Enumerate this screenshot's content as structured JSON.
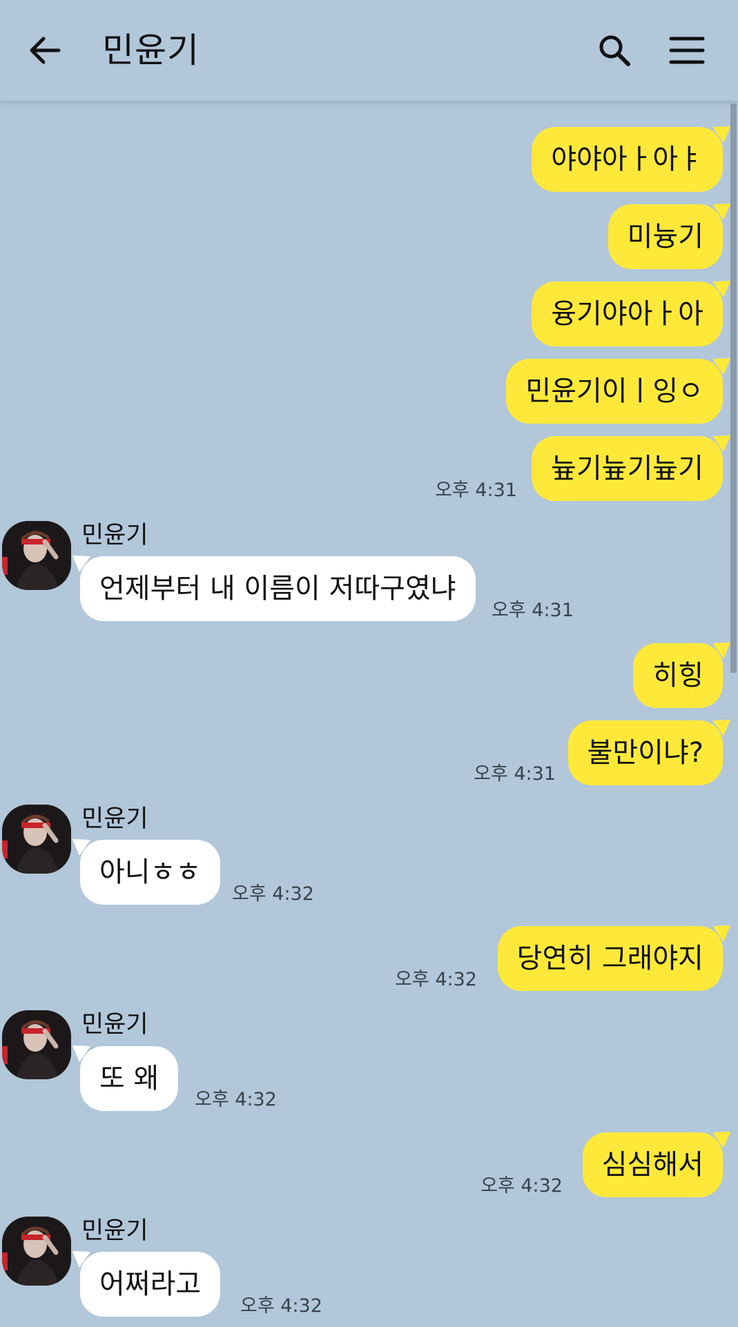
{
  "header": {
    "title": "민윤기",
    "back_icon": "arrow-left-icon",
    "search_icon": "search-icon",
    "menu_icon": "hamburger-menu-icon"
  },
  "colors": {
    "background": "#b2c7da",
    "my_bubble": "#fee93a",
    "their_bubble": "#ffffff"
  },
  "messages": [
    {
      "from": "me",
      "text": "야야아ㅏ아ㅑ"
    },
    {
      "from": "me",
      "text": "미늉기"
    },
    {
      "from": "me",
      "text": "융기야아ㅏ아"
    },
    {
      "from": "me",
      "text": "민윤기이ㅣ잉ㅇ"
    },
    {
      "from": "me",
      "text": "늎기늎기늎기",
      "time": "오후 4:31"
    },
    {
      "from": "them",
      "sender": "민윤기",
      "text": "언제부터 내 이름이 저따구였냐",
      "time": "오후 4:31"
    },
    {
      "from": "me",
      "text": "히힝"
    },
    {
      "from": "me",
      "text": "불만이냐?",
      "time": "오후 4:31"
    },
    {
      "from": "them",
      "sender": "민윤기",
      "text": "아니ㅎㅎ",
      "time": "오후 4:32"
    },
    {
      "from": "me",
      "text": "당연히 그래야지",
      "time": "오후 4:32"
    },
    {
      "from": "them",
      "sender": "민윤기",
      "text": "또 왜",
      "time": "오후 4:32"
    },
    {
      "from": "me",
      "text": "심심해서",
      "time": "오후 4:32"
    },
    {
      "from": "them",
      "sender": "민윤기",
      "text": "어쩌라고",
      "time": "오후 4:32"
    }
  ]
}
